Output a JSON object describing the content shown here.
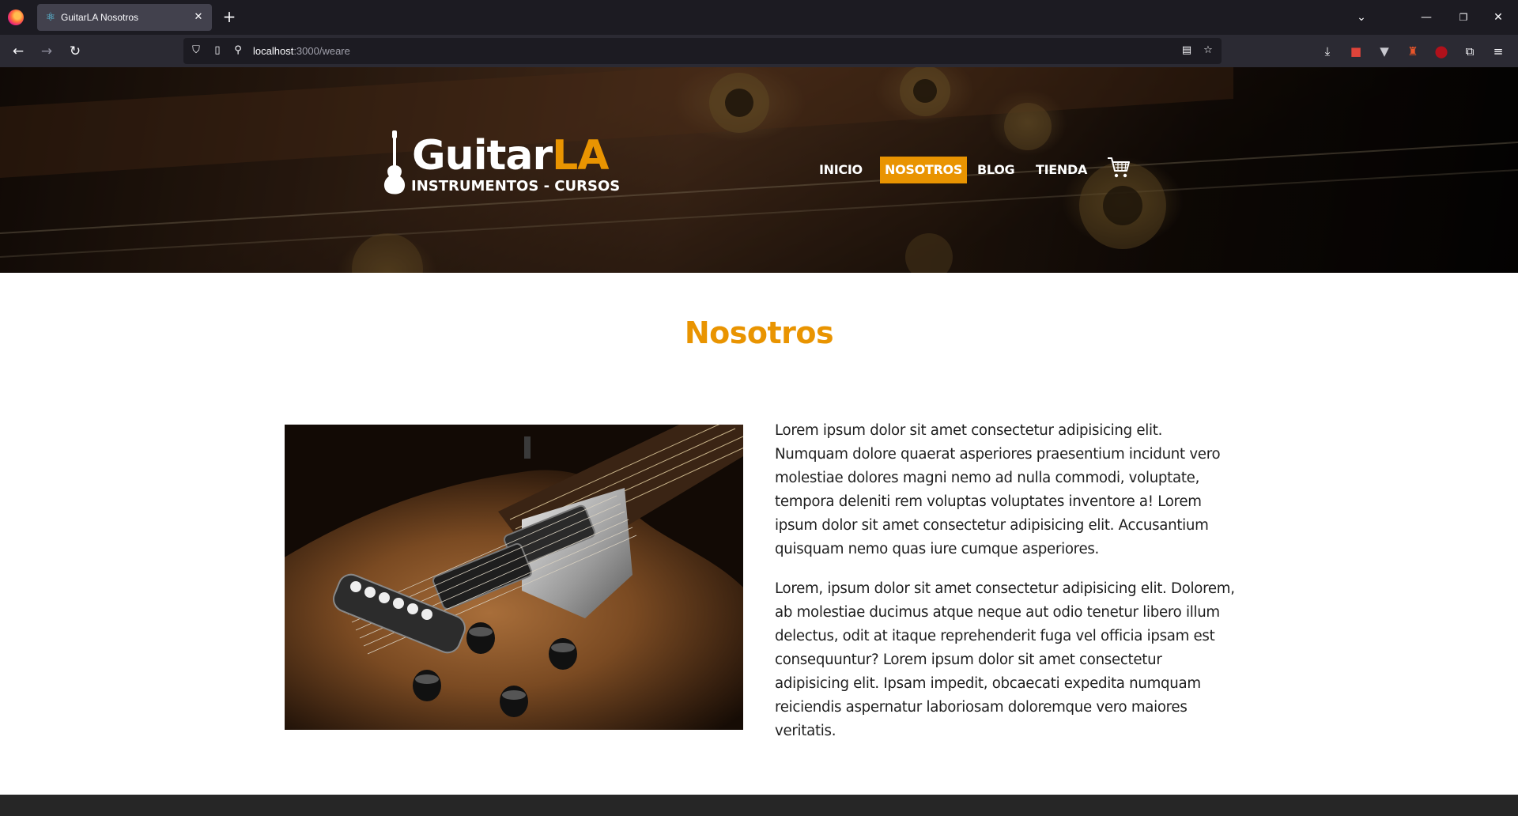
{
  "browser": {
    "tab_title": "GuitarLA Nosotros",
    "url_host": "localhost",
    "url_path": ":3000/weare",
    "icons": [
      "firefox-logo",
      "react-favicon",
      "close-icon",
      "plus-icon",
      "chevron-down-icon",
      "minimize-icon",
      "restore-icon",
      "close-window-icon",
      "back-icon",
      "forward-icon",
      "reload-icon",
      "shield-icon",
      "page-icon",
      "permissions-icon",
      "reader-icon",
      "star-icon",
      "download-icon",
      "extension-icon",
      "menu-icon"
    ]
  },
  "header": {
    "logo": {
      "word_white": "Guitar",
      "word_accent": "LA",
      "subtitle": "INSTRUMENTOS - CURSOS"
    },
    "nav": [
      {
        "label": "INICIO",
        "active": false
      },
      {
        "label": "NOSOTROS",
        "active": true
      },
      {
        "label": "BLOG",
        "active": false
      },
      {
        "label": "TIENDA",
        "active": false
      }
    ],
    "cart_icon": "shopping-cart-icon"
  },
  "main": {
    "title": "Nosotros",
    "paragraphs": [
      "Lorem ipsum dolor sit amet consectetur adipisicing elit. Numquam dolore quaerat asperiores praesentium incidunt vero molestiae dolores magni nemo ad nulla commodi, voluptate, tempora deleniti rem voluptas voluptates inventore a! Lorem ipsum dolor sit amet consectetur adipisicing elit. Accusantium quisquam nemo quas iure cumque asperiores.",
      "Lorem, ipsum dolor sit amet consectetur adipisicing elit. Dolorem, ab molestiae ducimus atque neque aut odio tenetur libero illum delectus, odit at itaque reprehenderit fuga vel officia ipsam est consequuntur? Lorem ipsum dolor sit amet consectetur adipisicing elit. Ipsam impedit, obcaecati expedita numquam reiciendis aspernatur laboriosam doloremque vero maiores veritatis."
    ]
  },
  "colors": {
    "accent": "#e99401",
    "text": "#1e1e1e",
    "footer": "#262626",
    "chrome_dark": "#1c1b22",
    "chrome_toolbar": "#2b2a33"
  }
}
